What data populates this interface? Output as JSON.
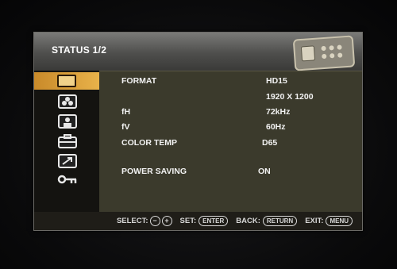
{
  "osd": {
    "title": "STATUS 1/2",
    "sidebar": [
      {
        "icon": "picture-adjust-icon",
        "active": true
      },
      {
        "icon": "color-icon",
        "active": false
      },
      {
        "icon": "user-icon",
        "active": false
      },
      {
        "icon": "toolbox-icon",
        "active": false
      },
      {
        "icon": "arrow-icon",
        "active": false
      },
      {
        "icon": "key-icon",
        "active": false
      }
    ],
    "rows": [
      {
        "label": "FORMAT",
        "value": "HD15"
      },
      {
        "label": "",
        "value": "1920 X 1200"
      },
      {
        "label": "fH",
        "value": "72kHz"
      },
      {
        "label": "fV",
        "value": "60Hz"
      },
      {
        "label": "COLOR TEMP",
        "value": "D65"
      },
      {
        "label": "POWER SAVING",
        "value": "ON"
      }
    ],
    "footer": {
      "select": "SELECT:",
      "set": "SET:",
      "set_btn": "ENTER",
      "back": "BACK:",
      "back_btn": "RETURN",
      "exit": "EXIT:",
      "exit_btn": "MENU"
    }
  },
  "colors": {
    "highlight": "#e8b24a",
    "panel": "#3b3a2c"
  }
}
